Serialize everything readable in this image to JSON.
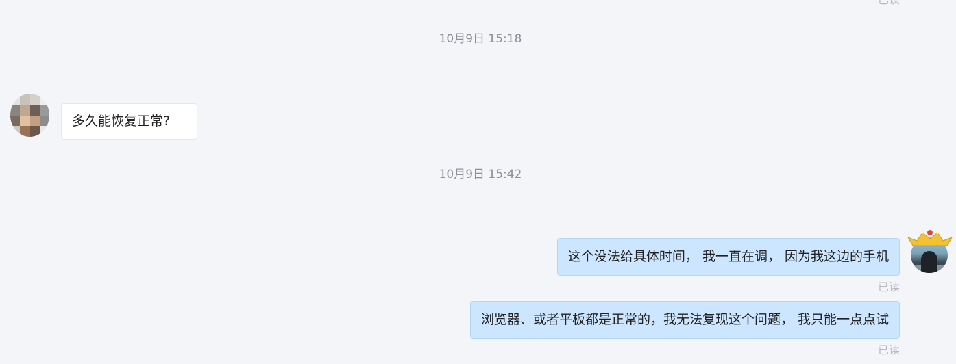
{
  "read_label": "已读",
  "avatar_left": {
    "pixels": [
      "#e6e2de",
      "#c8c2ba",
      "#d5d0cb",
      "#eeeeee",
      "#8a8480",
      "#bfa890",
      "#6d5f55",
      "#9a9a9a",
      "#7a6a60",
      "#e2c0a0",
      "#c2a080",
      "#8c8c8c",
      "#cfc8c0",
      "#9a7258",
      "#6a5848",
      "#e8e8e8"
    ]
  },
  "avatar_right": {
    "crown_color": "#f2c230",
    "crown_gem_color": "#e8423c"
  },
  "messages": [
    {
      "timestamp": "10月9日 15:18",
      "text": "多久能恢复正常?"
    },
    {
      "timestamp": "10月9日 15:42",
      "text": "这个没法给具体时间， 我一直在调， 因为我这边的手机"
    },
    {
      "text": "浏览器、或者平板都是正常的，我无法复现这个问题， 我只能一点点试"
    }
  ],
  "colors": {
    "background": "#f4f5f8",
    "bubble_self": "#cde6ff",
    "bubble_other": "#ffffff",
    "read_status": "#b8bac0",
    "timestamp": "#8d9096"
  }
}
